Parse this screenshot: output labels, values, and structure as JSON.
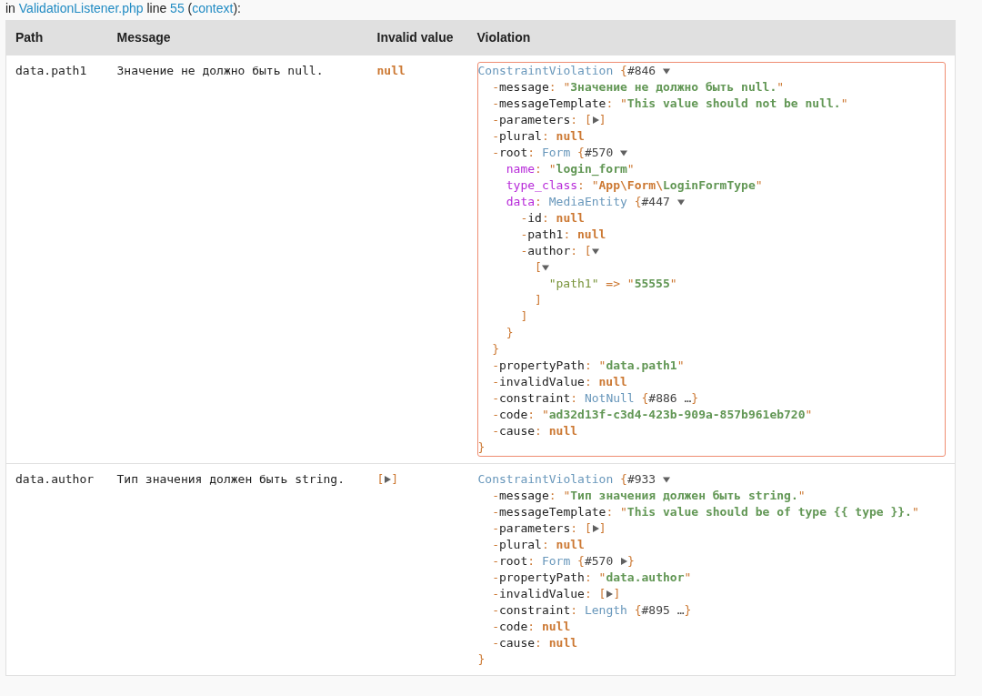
{
  "source_location": {
    "parts": [
      {
        "kind": "text",
        "text": "in "
      },
      {
        "kind": "link",
        "text": "ValidationListener.php"
      },
      {
        "kind": "text",
        "text": " line "
      },
      {
        "kind": "link",
        "text": "55"
      },
      {
        "kind": "text",
        "text": " ("
      },
      {
        "kind": "link",
        "text": "context"
      },
      {
        "kind": "text",
        "text": "):"
      }
    ]
  },
  "table": {
    "columns": [
      "Path",
      "Message",
      "Invalid value",
      "Violation"
    ],
    "rows": [
      {
        "path": "data.path1",
        "message": "Значение не должно быть null.",
        "invalid_value": [
          {
            "kind": "null",
            "text": "null"
          }
        ],
        "violation": {
          "highlighted": true,
          "root": {
            "tokens": [
              {
                "kind": "class",
                "text": "ConstraintViolation"
              },
              {
                "kind": "punct",
                "text": " {"
              },
              {
                "kind": "ref",
                "text": "#846 "
              },
              {
                "kind": "toggle",
                "expanded": true
              }
            ],
            "children": [
              {
                "tokens": [
                  {
                    "kind": "dash",
                    "text": "-"
                  },
                  {
                    "kind": "key",
                    "text": "message"
                  },
                  {
                    "kind": "punct",
                    "text": ": \""
                  },
                  {
                    "kind": "str",
                    "text": "Значение не должно быть null."
                  },
                  {
                    "kind": "punct",
                    "text": "\""
                  }
                ]
              },
              {
                "tokens": [
                  {
                    "kind": "dash",
                    "text": "-"
                  },
                  {
                    "kind": "key",
                    "text": "messageTemplate"
                  },
                  {
                    "kind": "punct",
                    "text": ": \""
                  },
                  {
                    "kind": "str",
                    "text": "This value should not be null."
                  },
                  {
                    "kind": "punct",
                    "text": "\""
                  }
                ]
              },
              {
                "tokens": [
                  {
                    "kind": "dash",
                    "text": "-"
                  },
                  {
                    "kind": "key",
                    "text": "parameters"
                  },
                  {
                    "kind": "punct",
                    "text": ": ["
                  },
                  {
                    "kind": "toggle",
                    "expanded": false
                  },
                  {
                    "kind": "punct",
                    "text": "]"
                  }
                ]
              },
              {
                "tokens": [
                  {
                    "kind": "dash",
                    "text": "-"
                  },
                  {
                    "kind": "key",
                    "text": "plural"
                  },
                  {
                    "kind": "punct",
                    "text": ": "
                  },
                  {
                    "kind": "null",
                    "text": "null"
                  }
                ]
              },
              {
                "tokens": [
                  {
                    "kind": "dash",
                    "text": "-"
                  },
                  {
                    "kind": "key",
                    "text": "root"
                  },
                  {
                    "kind": "punct",
                    "text": ": "
                  },
                  {
                    "kind": "class",
                    "text": "Form"
                  },
                  {
                    "kind": "punct",
                    "text": " {"
                  },
                  {
                    "kind": "ref",
                    "text": "#570 "
                  },
                  {
                    "kind": "toggle",
                    "expanded": true
                  }
                ],
                "children": [
                  {
                    "tokens": [
                      {
                        "kind": "pkey",
                        "text": "name"
                      },
                      {
                        "kind": "punct",
                        "text": ": \""
                      },
                      {
                        "kind": "str",
                        "text": "login_form"
                      },
                      {
                        "kind": "punct",
                        "text": "\""
                      }
                    ]
                  },
                  {
                    "tokens": [
                      {
                        "kind": "pkey",
                        "text": "type_class"
                      },
                      {
                        "kind": "punct",
                        "text": ": \""
                      },
                      {
                        "kind": "ns",
                        "text": "App\\Form\\"
                      },
                      {
                        "kind": "str",
                        "text": "LoginFormType"
                      },
                      {
                        "kind": "punct",
                        "text": "\""
                      }
                    ]
                  },
                  {
                    "tokens": [
                      {
                        "kind": "pkey",
                        "text": "data"
                      },
                      {
                        "kind": "punct",
                        "text": ": "
                      },
                      {
                        "kind": "class",
                        "text": "MediaEntity"
                      },
                      {
                        "kind": "punct",
                        "text": " {"
                      },
                      {
                        "kind": "ref",
                        "text": "#447 "
                      },
                      {
                        "kind": "toggle",
                        "expanded": true
                      }
                    ],
                    "children": [
                      {
                        "tokens": [
                          {
                            "kind": "dash",
                            "text": "-"
                          },
                          {
                            "kind": "key",
                            "text": "id"
                          },
                          {
                            "kind": "punct",
                            "text": ": "
                          },
                          {
                            "kind": "null",
                            "text": "null"
                          }
                        ]
                      },
                      {
                        "tokens": [
                          {
                            "kind": "dash",
                            "text": "-"
                          },
                          {
                            "kind": "key",
                            "text": "path1"
                          },
                          {
                            "kind": "punct",
                            "text": ": "
                          },
                          {
                            "kind": "null",
                            "text": "null"
                          }
                        ]
                      },
                      {
                        "tokens": [
                          {
                            "kind": "dash",
                            "text": "-"
                          },
                          {
                            "kind": "key",
                            "text": "author"
                          },
                          {
                            "kind": "punct",
                            "text": ": ["
                          },
                          {
                            "kind": "toggle",
                            "expanded": true
                          }
                        ],
                        "children": [
                          {
                            "tokens": [
                              {
                                "kind": "punct",
                                "text": "["
                              },
                              {
                                "kind": "toggle",
                                "expanded": true
                              }
                            ],
                            "children": [
                              {
                                "tokens": [
                                  {
                                    "kind": "akey",
                                    "text": "\"path1\""
                                  },
                                  {
                                    "kind": "punct",
                                    "text": " => \""
                                  },
                                  {
                                    "kind": "str",
                                    "text": "55555"
                                  },
                                  {
                                    "kind": "punct",
                                    "text": "\""
                                  }
                                ]
                              }
                            ],
                            "close": [
                              {
                                "kind": "punct",
                                "text": "]"
                              }
                            ]
                          }
                        ],
                        "close": [
                          {
                            "kind": "punct",
                            "text": "]"
                          }
                        ]
                      }
                    ],
                    "close": [
                      {
                        "kind": "punct",
                        "text": "}"
                      }
                    ]
                  }
                ],
                "close": [
                  {
                    "kind": "punct",
                    "text": "}"
                  }
                ]
              },
              {
                "tokens": [
                  {
                    "kind": "dash",
                    "text": "-"
                  },
                  {
                    "kind": "key",
                    "text": "propertyPath"
                  },
                  {
                    "kind": "punct",
                    "text": ": \""
                  },
                  {
                    "kind": "str",
                    "text": "data.path1"
                  },
                  {
                    "kind": "punct",
                    "text": "\""
                  }
                ]
              },
              {
                "tokens": [
                  {
                    "kind": "dash",
                    "text": "-"
                  },
                  {
                    "kind": "key",
                    "text": "invalidValue"
                  },
                  {
                    "kind": "punct",
                    "text": ": "
                  },
                  {
                    "kind": "null",
                    "text": "null"
                  }
                ]
              },
              {
                "tokens": [
                  {
                    "kind": "dash",
                    "text": "-"
                  },
                  {
                    "kind": "key",
                    "text": "constraint"
                  },
                  {
                    "kind": "punct",
                    "text": ": "
                  },
                  {
                    "kind": "class",
                    "text": "NotNull"
                  },
                  {
                    "kind": "punct",
                    "text": " {"
                  },
                  {
                    "kind": "ref",
                    "text": "#886 …"
                  },
                  {
                    "kind": "punct",
                    "text": "}"
                  }
                ]
              },
              {
                "tokens": [
                  {
                    "kind": "dash",
                    "text": "-"
                  },
                  {
                    "kind": "key",
                    "text": "code"
                  },
                  {
                    "kind": "punct",
                    "text": ": \""
                  },
                  {
                    "kind": "str",
                    "text": "ad32d13f-c3d4-423b-909a-857b961eb720"
                  },
                  {
                    "kind": "punct",
                    "text": "\""
                  }
                ]
              },
              {
                "tokens": [
                  {
                    "kind": "dash",
                    "text": "-"
                  },
                  {
                    "kind": "key",
                    "text": "cause"
                  },
                  {
                    "kind": "punct",
                    "text": ": "
                  },
                  {
                    "kind": "null",
                    "text": "null"
                  }
                ]
              }
            ],
            "close": [
              {
                "kind": "punct",
                "text": "}"
              }
            ]
          }
        }
      },
      {
        "path": "data.author",
        "message": "Тип значения должен быть string.",
        "invalid_value": [
          {
            "kind": "punct",
            "text": "["
          },
          {
            "kind": "toggle",
            "expanded": false
          },
          {
            "kind": "punct",
            "text": "]"
          }
        ],
        "violation": {
          "highlighted": false,
          "root": {
            "tokens": [
              {
                "kind": "class",
                "text": "ConstraintViolation"
              },
              {
                "kind": "punct",
                "text": " {"
              },
              {
                "kind": "ref",
                "text": "#933 "
              },
              {
                "kind": "toggle",
                "expanded": true
              }
            ],
            "children": [
              {
                "tokens": [
                  {
                    "kind": "dash",
                    "text": "-"
                  },
                  {
                    "kind": "key",
                    "text": "message"
                  },
                  {
                    "kind": "punct",
                    "text": ": \""
                  },
                  {
                    "kind": "str",
                    "text": "Тип значения должен быть string."
                  },
                  {
                    "kind": "punct",
                    "text": "\""
                  }
                ]
              },
              {
                "tokens": [
                  {
                    "kind": "dash",
                    "text": "-"
                  },
                  {
                    "kind": "key",
                    "text": "messageTemplate"
                  },
                  {
                    "kind": "punct",
                    "text": ": \""
                  },
                  {
                    "kind": "str",
                    "text": "This value should be of type {{ type }}."
                  },
                  {
                    "kind": "punct",
                    "text": "\""
                  }
                ]
              },
              {
                "tokens": [
                  {
                    "kind": "dash",
                    "text": "-"
                  },
                  {
                    "kind": "key",
                    "text": "parameters"
                  },
                  {
                    "kind": "punct",
                    "text": ": ["
                  },
                  {
                    "kind": "toggle",
                    "expanded": false
                  },
                  {
                    "kind": "punct",
                    "text": "]"
                  }
                ]
              },
              {
                "tokens": [
                  {
                    "kind": "dash",
                    "text": "-"
                  },
                  {
                    "kind": "key",
                    "text": "plural"
                  },
                  {
                    "kind": "punct",
                    "text": ": "
                  },
                  {
                    "kind": "null",
                    "text": "null"
                  }
                ]
              },
              {
                "tokens": [
                  {
                    "kind": "dash",
                    "text": "-"
                  },
                  {
                    "kind": "key",
                    "text": "root"
                  },
                  {
                    "kind": "punct",
                    "text": ": "
                  },
                  {
                    "kind": "class",
                    "text": "Form"
                  },
                  {
                    "kind": "punct",
                    "text": " {"
                  },
                  {
                    "kind": "ref",
                    "text": "#570 "
                  },
                  {
                    "kind": "toggle",
                    "expanded": false
                  },
                  {
                    "kind": "punct",
                    "text": "}"
                  }
                ]
              },
              {
                "tokens": [
                  {
                    "kind": "dash",
                    "text": "-"
                  },
                  {
                    "kind": "key",
                    "text": "propertyPath"
                  },
                  {
                    "kind": "punct",
                    "text": ": \""
                  },
                  {
                    "kind": "str",
                    "text": "data.author"
                  },
                  {
                    "kind": "punct",
                    "text": "\""
                  }
                ]
              },
              {
                "tokens": [
                  {
                    "kind": "dash",
                    "text": "-"
                  },
                  {
                    "kind": "key",
                    "text": "invalidValue"
                  },
                  {
                    "kind": "punct",
                    "text": ": ["
                  },
                  {
                    "kind": "toggle",
                    "expanded": false
                  },
                  {
                    "kind": "punct",
                    "text": "]"
                  }
                ]
              },
              {
                "tokens": [
                  {
                    "kind": "dash",
                    "text": "-"
                  },
                  {
                    "kind": "key",
                    "text": "constraint"
                  },
                  {
                    "kind": "punct",
                    "text": ": "
                  },
                  {
                    "kind": "class",
                    "text": "Length"
                  },
                  {
                    "kind": "punct",
                    "text": " {"
                  },
                  {
                    "kind": "ref",
                    "text": "#895 …"
                  },
                  {
                    "kind": "punct",
                    "text": "}"
                  }
                ]
              },
              {
                "tokens": [
                  {
                    "kind": "dash",
                    "text": "-"
                  },
                  {
                    "kind": "key",
                    "text": "code"
                  },
                  {
                    "kind": "punct",
                    "text": ": "
                  },
                  {
                    "kind": "null",
                    "text": "null"
                  }
                ]
              },
              {
                "tokens": [
                  {
                    "kind": "dash",
                    "text": "-"
                  },
                  {
                    "kind": "key",
                    "text": "cause"
                  },
                  {
                    "kind": "punct",
                    "text": ": "
                  },
                  {
                    "kind": "null",
                    "text": "null"
                  }
                ]
              }
            ],
            "close": [
              {
                "kind": "punct",
                "text": "}"
              }
            ]
          }
        }
      }
    ]
  }
}
